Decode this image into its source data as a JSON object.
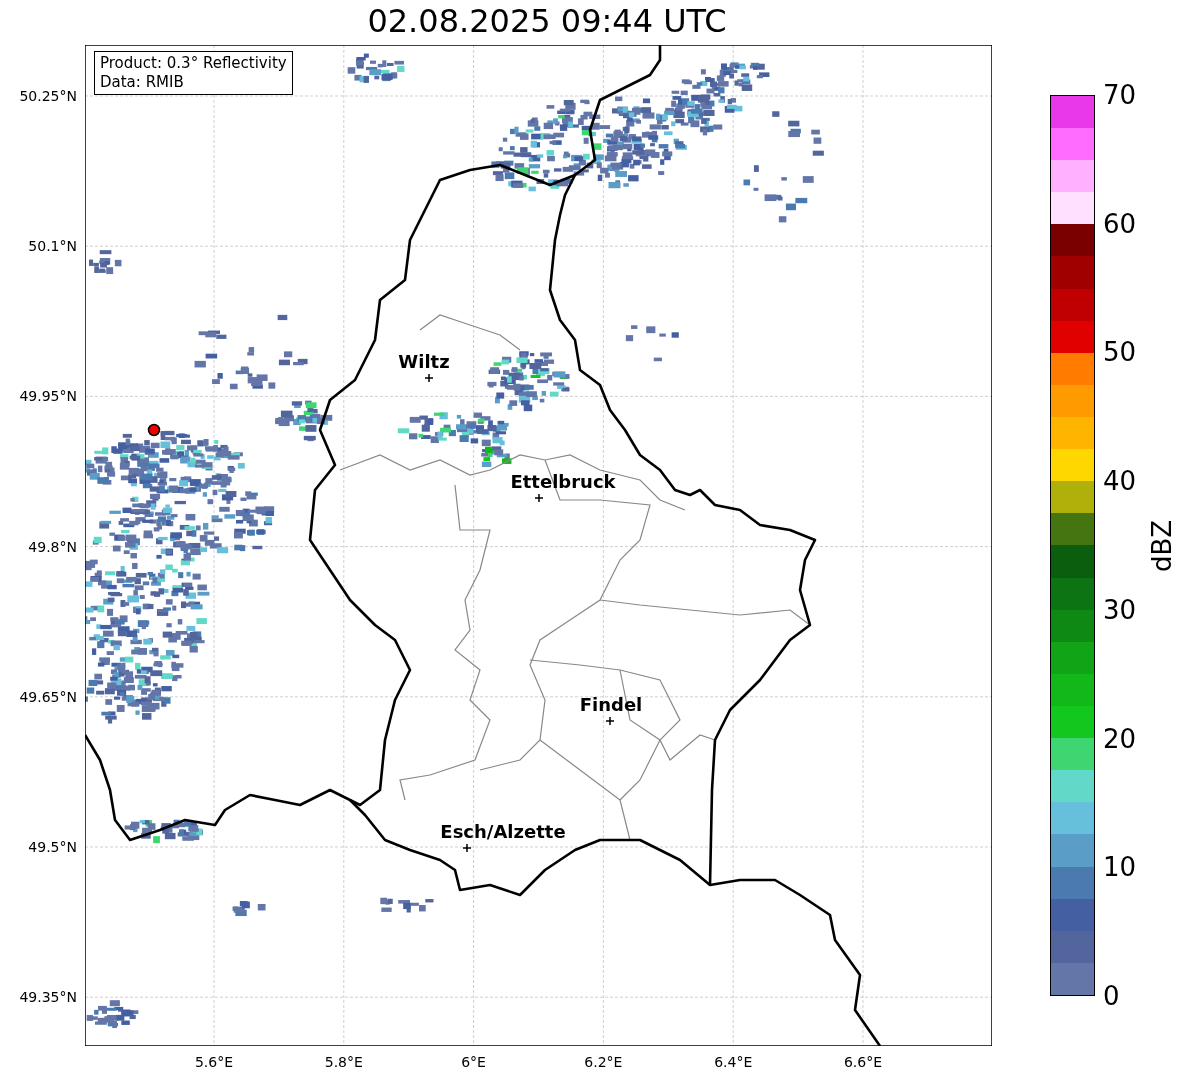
{
  "title": "02.08.2025 09:44 UTC",
  "annotation": [
    "Product: 0.3° Reflectivity",
    "Data: RMIB"
  ],
  "y_ticks": [
    "50.25°N",
    "50.1°N",
    "49.95°N",
    "49.8°N",
    "49.65°N",
    "49.5°N",
    "49.35°N"
  ],
  "x_ticks": [
    "5.6°E",
    "5.8°E",
    "6°E",
    "6.2°E",
    "6.4°E",
    "6.6°E"
  ],
  "cities": [
    {
      "name": "Wiltz"
    },
    {
      "name": "Ettelbruck"
    },
    {
      "name": "Findel"
    },
    {
      "name": "Esch/Alzette"
    }
  ],
  "colorbar": {
    "label": "dBZ",
    "ticks": [
      "70",
      "60",
      "50",
      "40",
      "30",
      "20",
      "10",
      "0"
    ],
    "bins": [
      {
        "color": "#6476a8"
      },
      {
        "color": "#52659c"
      },
      {
        "color": "#4460a2"
      },
      {
        "color": "#4a7ab0"
      },
      {
        "color": "#5a9ec8"
      },
      {
        "color": "#66c0dc"
      },
      {
        "color": "#62d8c8"
      },
      {
        "color": "#3ed670"
      },
      {
        "color": "#12c81e"
      },
      {
        "color": "#12b81a"
      },
      {
        "color": "#10a416"
      },
      {
        "color": "#0e8a14"
      },
      {
        "color": "#0c7412"
      },
      {
        "color": "#0a5e0e"
      },
      {
        "color": "#457510"
      },
      {
        "color": "#b0b00a"
      },
      {
        "color": "#ffd700"
      },
      {
        "color": "#ffb500"
      },
      {
        "color": "#ff9a00"
      },
      {
        "color": "#ff7c00"
      },
      {
        "color": "#e00000"
      },
      {
        "color": "#c00000"
      },
      {
        "color": "#a00000"
      },
      {
        "color": "#7a0000"
      },
      {
        "color": "#ffe0ff"
      },
      {
        "color": "#ffb0ff"
      },
      {
        "color": "#ff6cff"
      },
      {
        "color": "#e838e8"
      }
    ]
  }
}
